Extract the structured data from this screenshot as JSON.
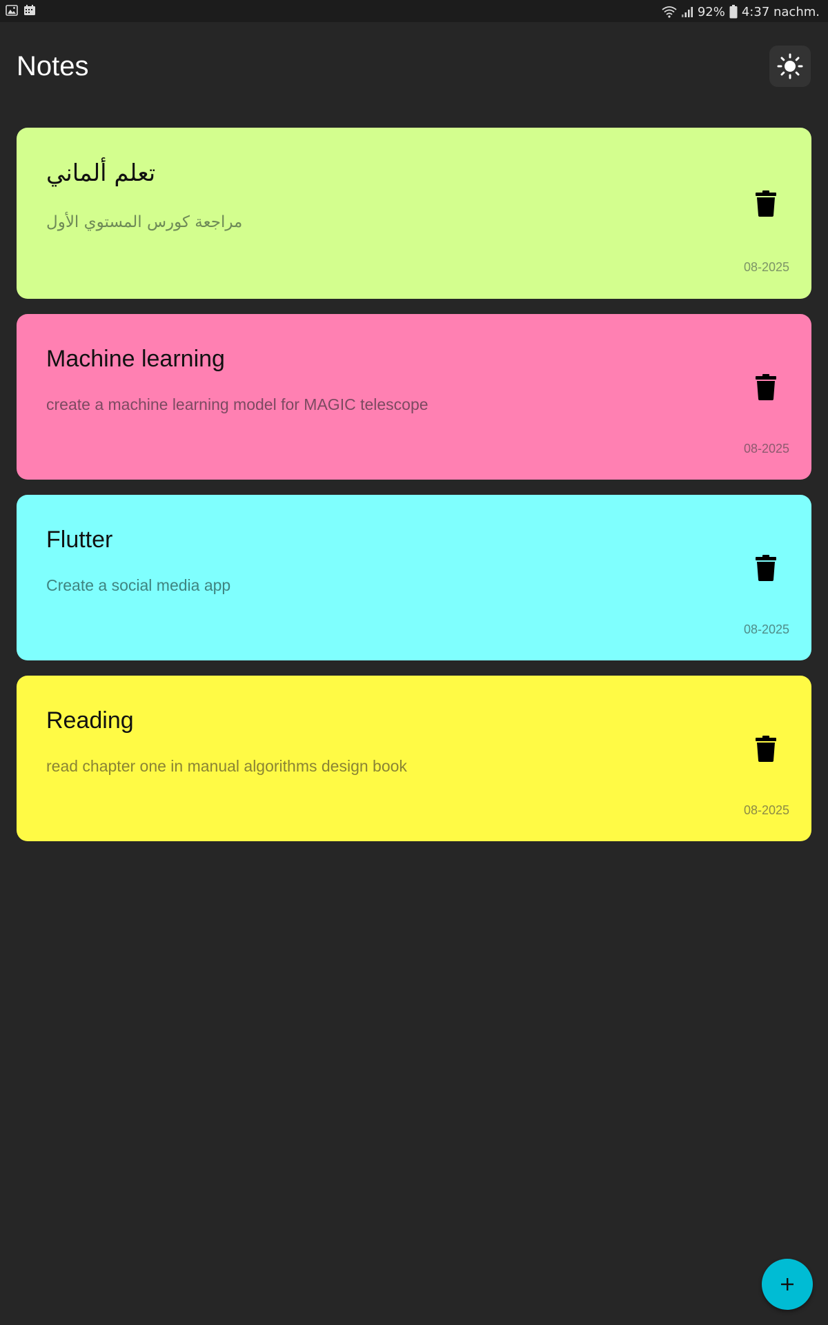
{
  "status_bar": {
    "left_icons": [
      "image-icon",
      "calendar-icon"
    ],
    "battery_percent": "92%",
    "time": "4:37 nachm.",
    "right_icons": [
      "wifi-icon",
      "signal-icon",
      "battery-icon"
    ]
  },
  "header": {
    "title": "Notes",
    "theme_toggle_icon": "sun-icon"
  },
  "notes": [
    {
      "title": "تعلم ألماني",
      "body": "مراجعة كورس المستوي الأول",
      "date": "08-2025",
      "color": "#d3fe8e",
      "body_color": "#6e8a57",
      "date_color": "#7c9467",
      "direction": "rtl"
    },
    {
      "title": "Machine learning",
      "body": "create a machine learning model for MAGIC telescope",
      "date": "08-2025",
      "color": "#ff80b2",
      "body_color": "#7c4a61",
      "date_color": "#8c5a6e",
      "direction": "ltr"
    },
    {
      "title": "Flutter",
      "body": "Create a social media app",
      "date": "08-2025",
      "color": "#7ffffe",
      "body_color": "#3f8480",
      "date_color": "#4f8c88",
      "direction": "ltr"
    },
    {
      "title": "Reading",
      "body": "read chapter one in manual algorithms design book",
      "date": "08-2025",
      "color": "#fffa45",
      "body_color": "#8a8434",
      "date_color": "#8c8a46",
      "direction": "ltr"
    }
  ],
  "fab": {
    "icon": "plus-icon",
    "color": "#00bcd4"
  },
  "colors": {
    "background": "#262626",
    "status_bar": "#1c1c1c",
    "theme_button": "#333333"
  }
}
